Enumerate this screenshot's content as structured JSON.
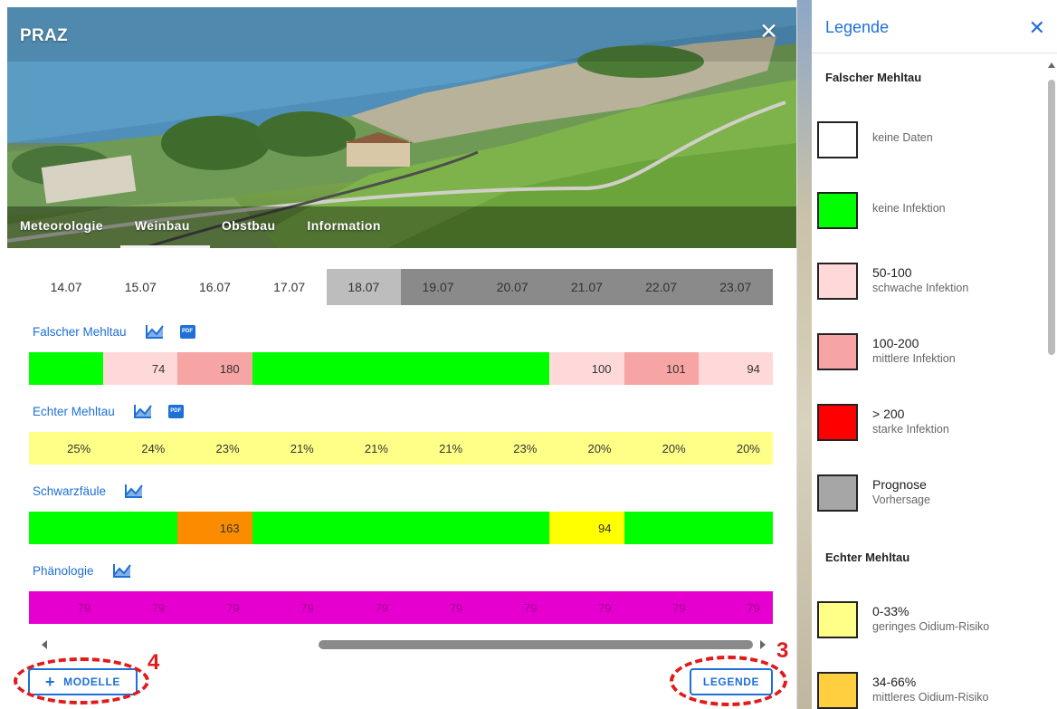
{
  "location": {
    "title": "PRAZ"
  },
  "tabs": [
    {
      "label": "Meteorologie"
    },
    {
      "label": "Weinbau"
    },
    {
      "label": "Obstbau"
    },
    {
      "label": "Information"
    }
  ],
  "active_tab": "Weinbau",
  "grid": {
    "dates": [
      "14.07",
      "15.07",
      "16.07",
      "17.07",
      "18.07",
      "19.07",
      "20.07",
      "21.07",
      "22.07",
      "23.07"
    ],
    "sections": [
      {
        "label": "Falscher Mehltau",
        "has_pdf": true,
        "cells": [
          {
            "value": "",
            "color": "green"
          },
          {
            "value": "74",
            "color": "pink"
          },
          {
            "value": "180",
            "color": "salmon"
          },
          {
            "value": "",
            "color": "green"
          },
          {
            "value": "",
            "color": "green"
          },
          {
            "value": "",
            "color": "green"
          },
          {
            "value": "",
            "color": "green"
          },
          {
            "value": "100",
            "color": "pink"
          },
          {
            "value": "101",
            "color": "salmon"
          },
          {
            "value": "94",
            "color": "pink"
          }
        ]
      },
      {
        "label": "Echter Mehltau",
        "has_pdf": true,
        "cells": [
          {
            "value": "25%",
            "color": "yellow"
          },
          {
            "value": "24%",
            "color": "yellow"
          },
          {
            "value": "23%",
            "color": "yellow"
          },
          {
            "value": "21%",
            "color": "yellow"
          },
          {
            "value": "21%",
            "color": "yellow"
          },
          {
            "value": "21%",
            "color": "yellow"
          },
          {
            "value": "23%",
            "color": "yellow"
          },
          {
            "value": "20%",
            "color": "yellow"
          },
          {
            "value": "20%",
            "color": "yellow"
          },
          {
            "value": "20%",
            "color": "yellow"
          }
        ]
      },
      {
        "label": "Schwarzfäule",
        "has_pdf": false,
        "cells": [
          {
            "value": "",
            "color": "green"
          },
          {
            "value": "",
            "color": "green"
          },
          {
            "value": "163",
            "color": "orange"
          },
          {
            "value": "",
            "color": "green"
          },
          {
            "value": "",
            "color": "green"
          },
          {
            "value": "",
            "color": "green"
          },
          {
            "value": "",
            "color": "green"
          },
          {
            "value": "94",
            "color": "yellow2"
          },
          {
            "value": "",
            "color": "green"
          },
          {
            "value": "",
            "color": "green"
          }
        ]
      },
      {
        "label": "Phänologie",
        "has_pdf": false,
        "cells": [
          {
            "value": "79",
            "color": "magenta"
          },
          {
            "value": "79",
            "color": "magenta"
          },
          {
            "value": "79",
            "color": "magenta"
          },
          {
            "value": "79",
            "color": "magenta"
          },
          {
            "value": "79",
            "color": "magenta"
          },
          {
            "value": "79",
            "color": "magenta"
          },
          {
            "value": "79",
            "color": "magenta"
          },
          {
            "value": "79",
            "color": "magenta"
          },
          {
            "value": "79",
            "color": "magenta"
          },
          {
            "value": "79",
            "color": "magenta"
          }
        ]
      }
    ],
    "pdf_label": "PDF",
    "header_shading": [
      "white",
      "white",
      "white",
      "white",
      "lightgray",
      "darkgray",
      "darkgray",
      "darkgray",
      "darkgray",
      "darkgray"
    ]
  },
  "buttons": {
    "modelle_plus": "+",
    "modelle_label": "MODELLE",
    "legende_label": "LEGENDE"
  },
  "annotations": {
    "left_number": "4",
    "right_number": "3"
  },
  "legend": {
    "title": "Legende",
    "close_icon": "close-icon",
    "sections": [
      {
        "heading": "Falscher Mehltau",
        "items": [
          {
            "color": "#ffffff",
            "primary": "",
            "secondary": "keine Daten"
          },
          {
            "color": "#00ff00",
            "primary": "",
            "secondary": "keine Infektion"
          },
          {
            "color": "#ffd9d9",
            "primary": "50-100",
            "secondary": "schwache Infektion"
          },
          {
            "color": "#f7a4a4",
            "primary": "100-200",
            "secondary": "mittlere Infektion"
          },
          {
            "color": "#ff0000",
            "primary": "> 200",
            "secondary": "starke Infektion"
          },
          {
            "color": "#a6a6a6",
            "primary": "Prognose",
            "secondary": "Vorhersage"
          }
        ]
      },
      {
        "heading": "Echter Mehltau",
        "items": [
          {
            "color": "#ffff88",
            "primary": "0-33%",
            "secondary": "geringes Oidium-Risiko"
          },
          {
            "color": "#ffcf40",
            "primary": "34-66%",
            "secondary": "mittleres Oidium-Risiko"
          }
        ]
      }
    ]
  },
  "colors": {
    "accent": "#1e6fd6",
    "annotation": "#e21a1a",
    "green": "#00ff00",
    "pink": "#ffd9d9",
    "salmon": "#f7a4a4",
    "yellow": "#ffff88",
    "yellow2": "#ffff00",
    "orange": "#fb8c00",
    "magenta": "#e600cf",
    "lightgray": "#bdbdbd",
    "darkgray": "#8a8a8a"
  }
}
